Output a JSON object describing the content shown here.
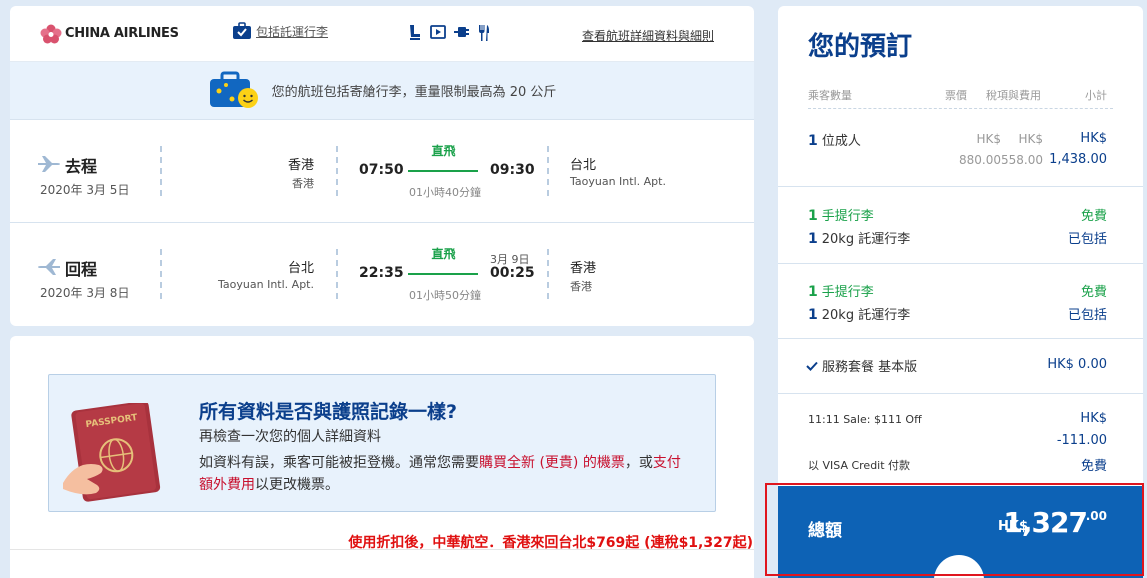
{
  "flight": {
    "airline": "CHINA AIRLINES",
    "baggage_link": "包括託運行李",
    "details_link": "查看航班詳細資料與細則",
    "notice": "您的航班包括寄艙行李，重量限制最高為 20 公斤",
    "segments": [
      {
        "label": "去程",
        "date": "2020年 3月 5日",
        "from_city": "香港",
        "from_apt": "香港",
        "dep_time": "07:50",
        "direct": "直飛",
        "duration": "01小時40分鐘",
        "arr_time": "09:30",
        "to_city": "台北",
        "to_apt": "Taoyuan Intl. Apt."
      },
      {
        "label": "回程",
        "date": "2020年 3月 8日",
        "from_city": "台北",
        "from_apt": "Taoyuan Intl. Apt.",
        "dep_time": "22:35",
        "direct": "直飛",
        "duration": "01小時50分鐘",
        "next_day": "3月 9日",
        "arr_time": "00:25",
        "to_city": "香港",
        "to_apt": "香港"
      }
    ]
  },
  "passport": {
    "title": "所有資料是否與護照記錄一樣?",
    "subtitle": "再檢查一次您的個人詳細資料",
    "body_1": "如資料有誤，乘客可能被拒登機。通常您需要",
    "body_link_1": "購買全新 (更貴) 的機票",
    "body_2": "，或",
    "body_link_2": "支付額外費用",
    "body_3": "以更改機票。",
    "passport_word": "PASSPORT"
  },
  "promo": "使用折扣後，中華航空．香港來回台北$769起 (連稅$1,327起)",
  "booking": {
    "title": "您的預訂",
    "headers": {
      "pax": "乘客數量",
      "fare": "票價",
      "tax": "稅項與費用",
      "subtotal": "小計"
    },
    "pax_count": "1",
    "pax_label": "位成人",
    "fare_cur": "HK$",
    "fare": "880.00",
    "tax_cur": "HK$",
    "tax": "558.00",
    "subtotal_cur": "HK$",
    "subtotal": "1,438.00",
    "bags": [
      {
        "carry_n": "1",
        "carry": "手提行李",
        "carry_status": "免費",
        "checked_n": "1",
        "checked": "20kg 託運行李",
        "checked_status": "已包括"
      },
      {
        "carry_n": "1",
        "carry": "手提行李",
        "carry_status": "免費",
        "checked_n": "1",
        "checked": "20kg 託運行李",
        "checked_status": "已包括"
      }
    ],
    "service": "服務套餐 基本版",
    "service_price": "HK$ 0.00",
    "sale_label": "11:11 Sale: $111 Off",
    "sale_cur": "HK$",
    "sale_amount": "-111.00",
    "visa_label": "以 VISA Credit 付款",
    "visa_status": "免費",
    "total_label": "總額",
    "total_cur": "HK$",
    "total_int": "1,327",
    "total_dec": ".00"
  },
  "colors": {
    "brand": "#0b3f8c",
    "green": "#1aa14a",
    "total_bg": "#0d62b5",
    "alert": "#e0161e"
  }
}
